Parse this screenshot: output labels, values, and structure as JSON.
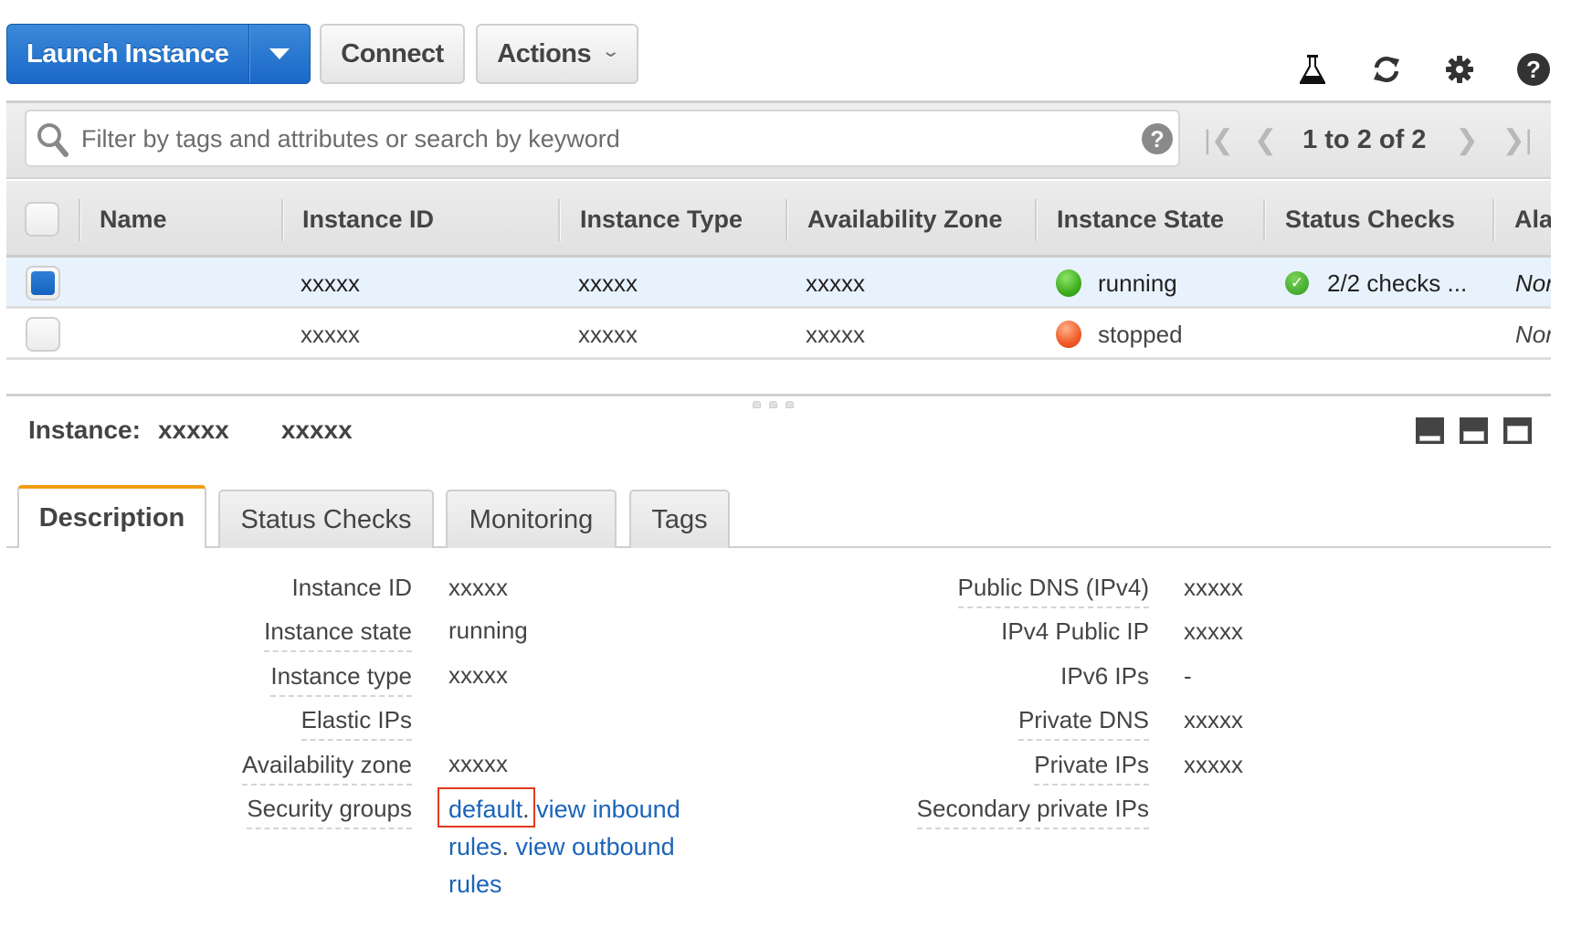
{
  "toolbar": {
    "launch_label": "Launch Instance",
    "connect_label": "Connect",
    "actions_label": "Actions",
    "icons": [
      "flask-icon",
      "refresh-icon",
      "gear-icon",
      "help-icon"
    ]
  },
  "search": {
    "placeholder": "Filter by tags and attributes or search by keyword",
    "value": ""
  },
  "pagination": {
    "text": "1 to 2 of 2"
  },
  "table": {
    "columns": [
      "Name",
      "Instance ID",
      "Instance Type",
      "Availability Zone",
      "Instance State",
      "Status Checks",
      "Ala"
    ],
    "rows": [
      {
        "selected": true,
        "name": "",
        "instance_id": "xxxxx",
        "instance_type": "xxxxx",
        "availability_zone": "xxxxx",
        "state": "running",
        "state_color": "#3fae1d",
        "status_checks": "2/2 checks ...",
        "alarm": "Nor"
      },
      {
        "selected": false,
        "name": "",
        "instance_id": "xxxxx",
        "instance_type": "xxxxx",
        "availability_zone": "xxxxx",
        "state": "stopped",
        "state_color": "#f05a28",
        "status_checks": "",
        "alarm": "Nor"
      }
    ]
  },
  "detail": {
    "title_label": "Instance:",
    "instance_id": "xxxxx",
    "instance_name": "xxxxx",
    "tabs": [
      "Description",
      "Status Checks",
      "Monitoring",
      "Tags"
    ],
    "active_tab": "Description",
    "left": [
      {
        "label": "Instance ID",
        "value": "xxxxx"
      },
      {
        "label": "Instance state",
        "value": "running"
      },
      {
        "label": "Instance type",
        "value": "xxxxx"
      },
      {
        "label": "Elastic IPs",
        "value": ""
      },
      {
        "label": "Availability zone",
        "value": "xxxxx"
      },
      {
        "label": "Security groups",
        "value": ""
      }
    ],
    "security_groups": {
      "group_link": "default",
      "inbound_link": "view inbound rules",
      "outbound_link": "view outbound rules"
    },
    "right": [
      {
        "label": "Public DNS (IPv4)",
        "value": "xxxxx"
      },
      {
        "label": "IPv4 Public IP",
        "value": "xxxxx"
      },
      {
        "label": "IPv6 IPs",
        "value": "-"
      },
      {
        "label": "Private DNS",
        "value": "xxxxx"
      },
      {
        "label": "Private IPs",
        "value": "xxxxx"
      },
      {
        "label": "Secondary private IPs",
        "value": ""
      }
    ]
  },
  "colors": {
    "primary": "#1a68c7",
    "link": "#1a64b8",
    "active_tab_accent": "#f39c12",
    "selected_row": "#e8f2fc",
    "highlight_box": "#e23a1f"
  }
}
